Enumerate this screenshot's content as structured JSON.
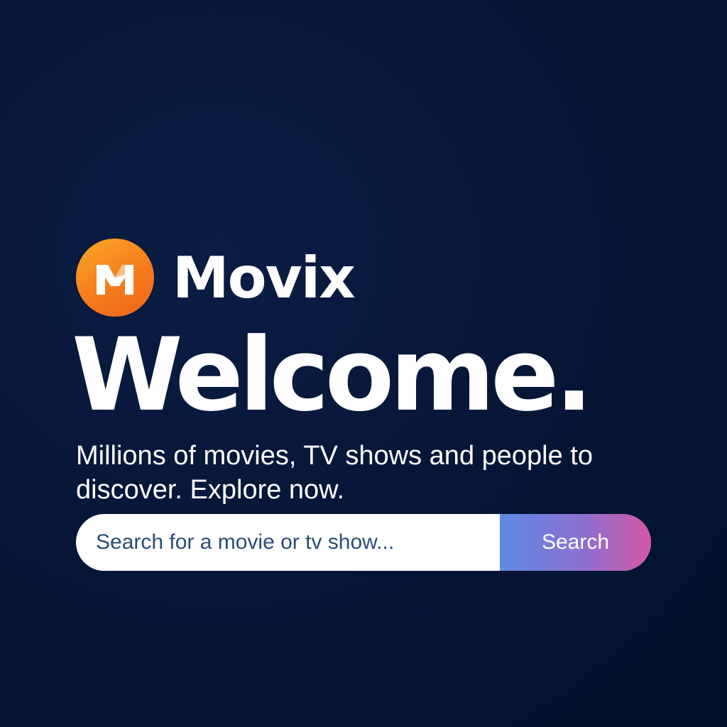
{
  "brand": {
    "logo_icon": "movix-logo-icon",
    "logo_letter": "M",
    "name": "Movix",
    "logo_color": "#f57c1d"
  },
  "hero": {
    "headline": "Welcome.",
    "tagline": "Millions of movies, TV shows and people to discover. Explore now."
  },
  "search": {
    "placeholder": "Search for a movie or tv show...",
    "value": "",
    "button_label": "Search",
    "button_gradient": [
      "#5e8ae6",
      "#d457a6"
    ]
  },
  "colors": {
    "background": "#04132f",
    "text": "#ffffff"
  }
}
